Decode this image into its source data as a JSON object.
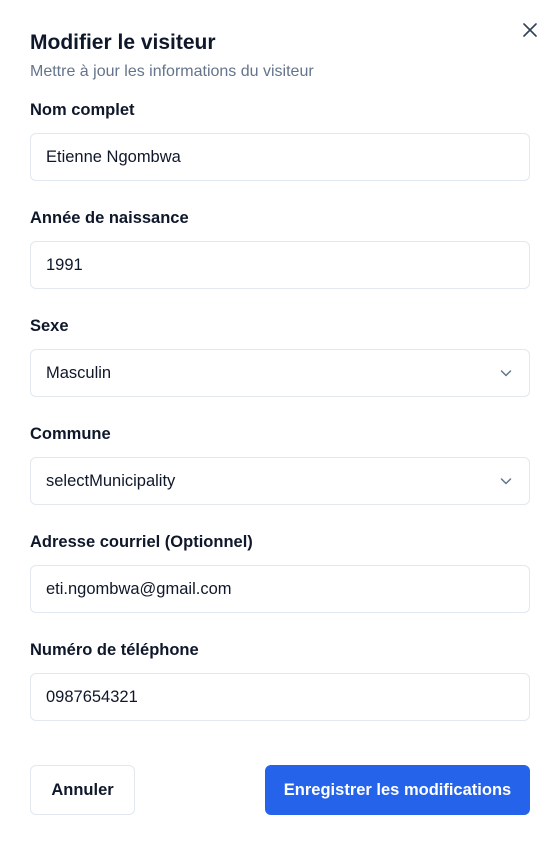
{
  "dialog": {
    "title": "Modifier le visiteur",
    "subtitle": "Mettre à jour les informations du visiteur",
    "close_icon": "close-icon"
  },
  "form": {
    "full_name": {
      "label": "Nom complet",
      "value": "Etienne Ngombwa"
    },
    "birth_year": {
      "label": "Année de naissance",
      "value": "1991"
    },
    "gender": {
      "label": "Sexe",
      "value": "Masculin"
    },
    "municipality": {
      "label": "Commune",
      "value": "selectMunicipality"
    },
    "email": {
      "label": "Adresse courriel (Optionnel)",
      "value": "eti.ngombwa@gmail.com"
    },
    "phone": {
      "label": "Numéro de téléphone",
      "value": "0987654321"
    }
  },
  "actions": {
    "cancel_label": "Annuler",
    "save_label": "Enregistrer les modifications"
  },
  "colors": {
    "primary": "#2563eb",
    "border": "#e2e8f0",
    "muted_text": "#64748b"
  }
}
